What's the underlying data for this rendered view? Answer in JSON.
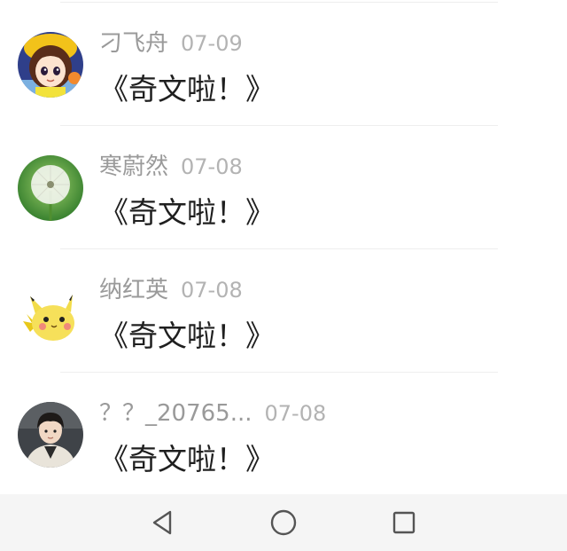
{
  "comments": [
    {
      "username": "刁飞舟",
      "date": "07-09",
      "content": "《奇文啦！》",
      "avatar_icon": "cartoon-girl-avatar"
    },
    {
      "username": "寒蔚然",
      "date": "07-08",
      "content": "《奇文啦！》",
      "avatar_icon": "dandelion-avatar"
    },
    {
      "username": "纳红英",
      "date": "07-08",
      "content": "《奇文啦！》",
      "avatar_icon": "pikachu-avatar"
    },
    {
      "username": "？？_20765...",
      "date": "07-08",
      "content": "《奇文啦！》",
      "avatar_icon": "young-man-photo-avatar"
    }
  ],
  "navbar": {
    "back_icon": "triangle-back-icon",
    "home_icon": "circle-home-icon",
    "recents_icon": "square-recents-icon"
  },
  "colors": {
    "username": "#9a9a9a",
    "date": "#b3b3b3",
    "content": "#1f1f1f",
    "divider": "#eeeeee",
    "navbar_bg": "#f5f5f5",
    "nav_icon": "#555555"
  }
}
